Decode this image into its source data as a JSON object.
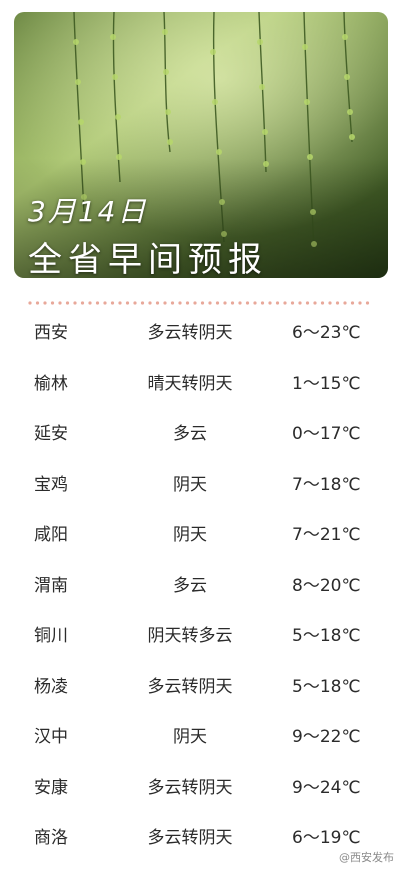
{
  "header": {
    "date": "3月14日",
    "title": "全省早间预报"
  },
  "forecast": [
    {
      "city": "西安",
      "weather": "多云转阴天",
      "temp": "6～23℃"
    },
    {
      "city": "榆林",
      "weather": "晴天转阴天",
      "temp": "1～15℃"
    },
    {
      "city": "延安",
      "weather": "多云",
      "temp": "0～17℃"
    },
    {
      "city": "宝鸡",
      "weather": "阴天",
      "temp": "7～18℃"
    },
    {
      "city": "咸阳",
      "weather": "阴天",
      "temp": "7～21℃"
    },
    {
      "city": "渭南",
      "weather": "多云",
      "temp": "8～20℃"
    },
    {
      "city": "铜川",
      "weather": "阴天转多云",
      "temp": "5～18℃"
    },
    {
      "city": "杨凌",
      "weather": "多云转阴天",
      "temp": "5～18℃"
    },
    {
      "city": "汉中",
      "weather": "阴天",
      "temp": "9～22℃"
    },
    {
      "city": "安康",
      "weather": "多云转阴天",
      "temp": "9～24℃"
    },
    {
      "city": "商洛",
      "weather": "多云转阴天",
      "temp": "6～19℃"
    }
  ],
  "watermark": "@西安发布",
  "colors": {
    "divider_dots": "#e8a89a",
    "text": "#2b2b2b",
    "hero_green_dark": "#2f4a1e",
    "hero_green_light": "#9fc36a"
  }
}
